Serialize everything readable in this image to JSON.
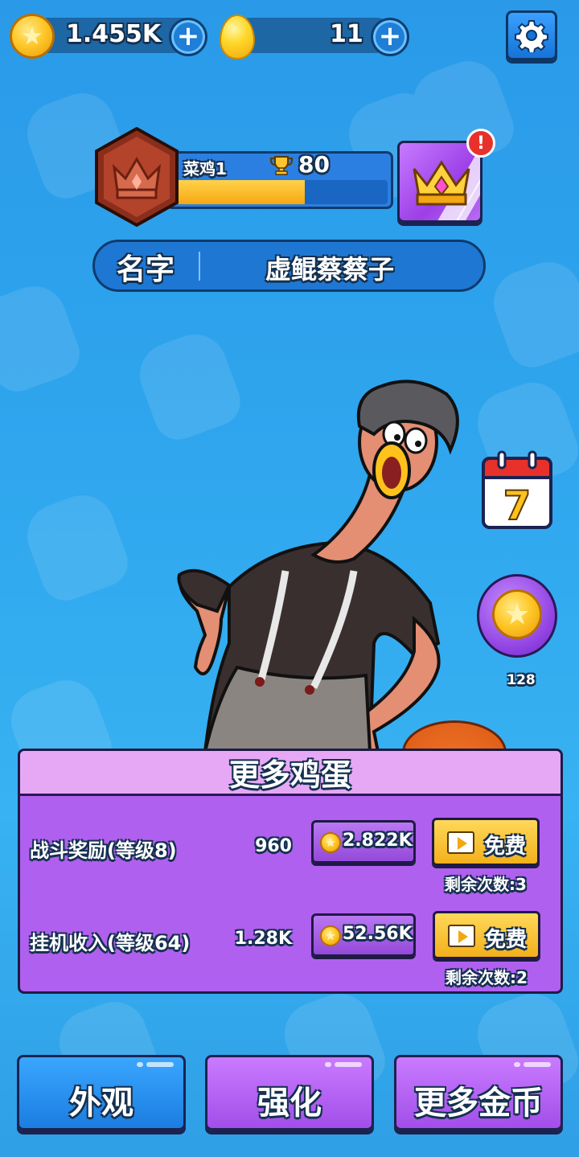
{
  "currency": {
    "coins": "1.455K",
    "eggs": "11"
  },
  "rank": {
    "name": "菜鸡1",
    "trophies": "80",
    "progress": 0.62
  },
  "profile": {
    "name_label": "名字",
    "name_value": "虚鲲蔡蔡子"
  },
  "side": {
    "calendar_day": "7",
    "coin_bonus_count": "128",
    "alert_mark": "!"
  },
  "eggs_panel": {
    "title": "更多鸡蛋",
    "rows": [
      {
        "label": "战斗奖励(等级8)",
        "amount": "960",
        "price": "2.822K",
        "free_label": "免费",
        "remaining": "剩余次数:3"
      },
      {
        "label": "挂机收入(等级64)",
        "amount": "1.28K",
        "price": "52.56K",
        "free_label": "免费",
        "remaining": "剩余次数:2"
      }
    ]
  },
  "nav": {
    "appearance": "外观",
    "upgrade": "强化",
    "more_coins": "更多金币"
  },
  "icons": [
    "star-coin-icon",
    "egg-icon",
    "plus-icon",
    "gear-icon",
    "trophy-icon",
    "crown-icon",
    "calendar-icon",
    "play-video-icon"
  ],
  "colors": {
    "background": "#2fa6ee",
    "panel_purple": "#b060ee",
    "button_yellow": "#f3b01b",
    "button_blue": "#1b7de0",
    "button_purple": "#a24ee9"
  }
}
